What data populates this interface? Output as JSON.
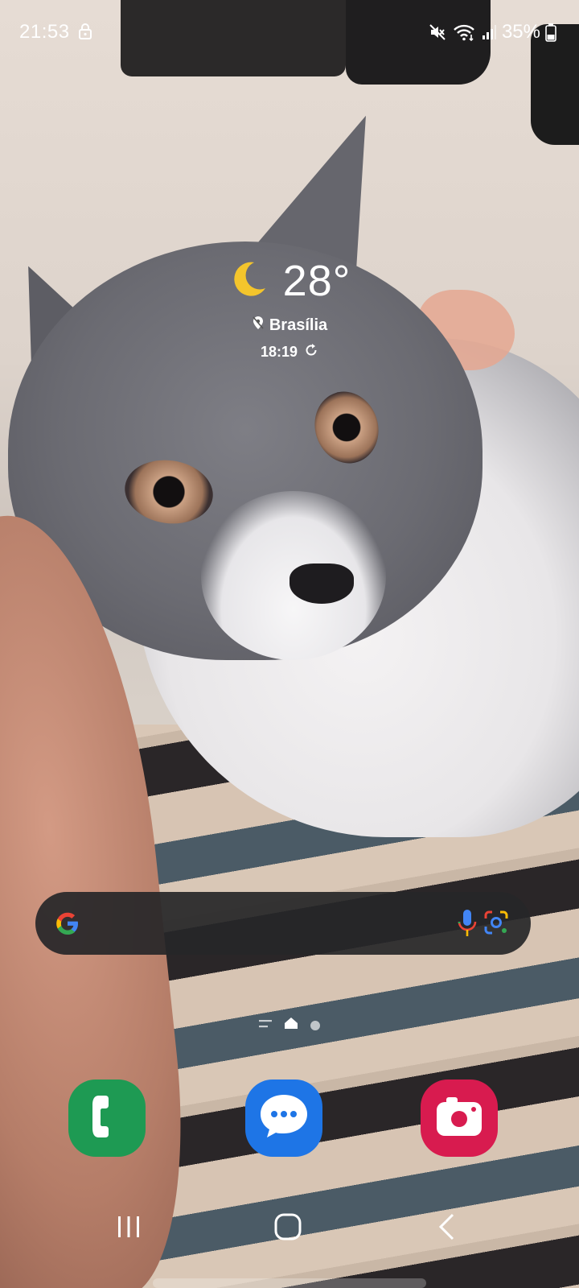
{
  "status_bar": {
    "time": "21:53",
    "battery": "35%",
    "icons": [
      "lock-icon",
      "mute-icon",
      "wifi-icon",
      "signal-icon",
      "battery-icon"
    ]
  },
  "weather_widget": {
    "temperature": "28°",
    "location": "Brasília",
    "updated_time": "18:19",
    "condition_icon": "moon-icon",
    "moon_color": "#f4c52c"
  },
  "search_bar": {
    "icons": [
      "google-logo-icon",
      "microphone-icon",
      "google-lens-icon"
    ]
  },
  "page_indicator": {
    "pages": [
      "feed",
      "home",
      "page-2"
    ],
    "current": 1
  },
  "dock": {
    "apps": [
      {
        "name": "phone",
        "icon": "phone-icon",
        "color": "#1e9a53"
      },
      {
        "name": "messages",
        "icon": "messages-icon",
        "color": "#1e75e6"
      },
      {
        "name": "camera",
        "icon": "camera-icon",
        "color": "#d81b4f"
      }
    ]
  },
  "nav_bar": {
    "buttons": [
      "recents",
      "home",
      "back"
    ]
  }
}
